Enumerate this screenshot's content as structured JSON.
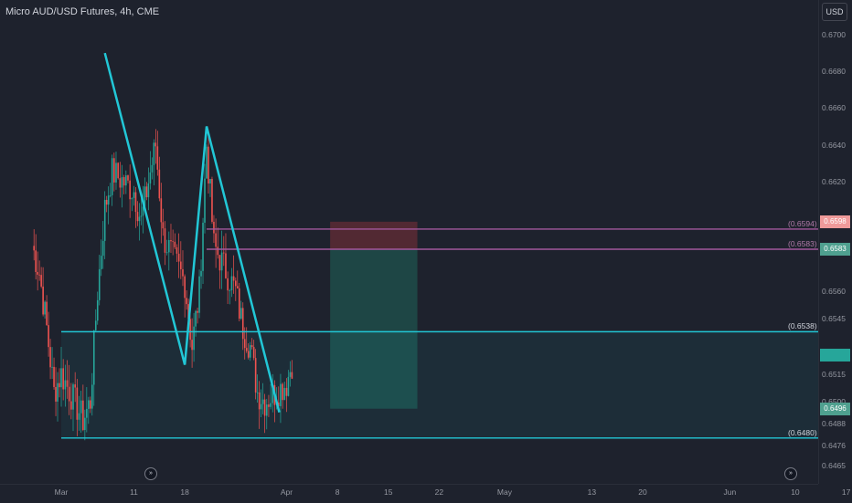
{
  "header": {
    "title": "Micro AUD/USD Futures, 4h, CME"
  },
  "price_scale": {
    "currency": "USD",
    "ticks": [
      {
        "label": "0.6700",
        "value": 0.67
      },
      {
        "label": "0.6680",
        "value": 0.668
      },
      {
        "label": "0.6660",
        "value": 0.666
      },
      {
        "label": "0.6640",
        "value": 0.664
      },
      {
        "label": "0.6620",
        "value": 0.662
      },
      {
        "label": "0.6560",
        "value": 0.656
      },
      {
        "label": "0.6545",
        "value": 0.6545
      },
      {
        "label": "0.6515",
        "value": 0.6515
      },
      {
        "label": "0.6500",
        "value": 0.65
      },
      {
        "label": "0.6488",
        "value": 0.6488
      },
      {
        "label": "0.6476",
        "value": 0.6476
      },
      {
        "label": "0.6465",
        "value": 0.6465
      }
    ],
    "badges": [
      {
        "label": "0.6598",
        "value": 0.6598,
        "color": "#ef9a9a"
      },
      {
        "label": "0.6583",
        "value": 0.6583,
        "color": "#4fa08f"
      },
      {
        "label": "",
        "value": 0.6525,
        "color": "#26a69a"
      },
      {
        "label": "0.6496",
        "value": 0.6496,
        "color": "#4fa08f"
      }
    ]
  },
  "levels": [
    {
      "label": "(0.6594)",
      "value": 0.6594,
      "color": "#a1579c",
      "start_date": "2024-03-21"
    },
    {
      "label": "(0.6583)",
      "value": 0.6583,
      "color": "#a1579c",
      "start_date": "2024-03-21"
    },
    {
      "label": "(0.6538)",
      "value": 0.6538,
      "color": "#22c7d6",
      "start_date": "2024-03-01"
    },
    {
      "label": "(0.6480)",
      "value": 0.648,
      "color": "#22c7d6",
      "start_date": "2024-03-01"
    }
  ],
  "time_axis": {
    "labels": [
      {
        "label": "Mar",
        "date": "2024-03-01"
      },
      {
        "label": "11",
        "date": "2024-03-11"
      },
      {
        "label": "18",
        "date": "2024-03-18"
      },
      {
        "label": "Apr",
        "date": "2024-04-01"
      },
      {
        "label": "8",
        "date": "2024-04-08"
      },
      {
        "label": "15",
        "date": "2024-04-15"
      },
      {
        "label": "22",
        "date": "2024-04-22"
      },
      {
        "label": "May",
        "date": "2024-05-01"
      },
      {
        "label": "13",
        "date": "2024-05-13"
      },
      {
        "label": "20",
        "date": "2024-05-20"
      },
      {
        "label": "Jun",
        "date": "2024-06-01"
      },
      {
        "label": "10",
        "date": "2024-06-10"
      },
      {
        "label": "17",
        "date": "2024-06-17"
      }
    ]
  },
  "colors": {
    "background": "#1e222d",
    "up_candle": "#26a69a",
    "down_candle": "#ef5350",
    "pattern_line": "#22c7d6",
    "stop_zone": "#5c2a35",
    "target_zone": "#1e4a48"
  },
  "chart_data": {
    "type": "candlestick",
    "symbol": "Micro AUD/USD Futures",
    "interval": "4h",
    "exchange": "CME",
    "ylim": [
      0.6462,
      0.6705
    ],
    "close_series": [
      {
        "date": "2024-02-26",
        "close": 0.6585
      },
      {
        "date": "2024-02-27",
        "close": 0.657
      },
      {
        "date": "2024-02-28",
        "close": 0.654
      },
      {
        "date": "2024-02-29",
        "close": 0.6505
      },
      {
        "date": "2024-03-01",
        "close": 0.6515
      },
      {
        "date": "2024-03-04",
        "close": 0.649
      },
      {
        "date": "2024-03-05",
        "close": 0.65
      },
      {
        "date": "2024-03-06",
        "close": 0.656
      },
      {
        "date": "2024-03-07",
        "close": 0.6605
      },
      {
        "date": "2024-03-08",
        "close": 0.6625
      },
      {
        "date": "2024-03-11",
        "close": 0.6615
      },
      {
        "date": "2024-03-12",
        "close": 0.6598
      },
      {
        "date": "2024-03-13",
        "close": 0.662
      },
      {
        "date": "2024-03-14",
        "close": 0.664
      },
      {
        "date": "2024-03-15",
        "close": 0.659
      },
      {
        "date": "2024-03-18",
        "close": 0.6565
      },
      {
        "date": "2024-03-19",
        "close": 0.653
      },
      {
        "date": "2024-03-20",
        "close": 0.656
      },
      {
        "date": "2024-03-21",
        "close": 0.664
      },
      {
        "date": "2024-03-22",
        "close": 0.6585
      },
      {
        "date": "2024-03-25",
        "close": 0.656
      },
      {
        "date": "2024-03-26",
        "close": 0.654
      },
      {
        "date": "2024-03-27",
        "close": 0.653
      },
      {
        "date": "2024-03-28",
        "close": 0.6505
      },
      {
        "date": "2024-03-29",
        "close": 0.65
      },
      {
        "date": "2024-04-01",
        "close": 0.651
      },
      {
        "date": "2024-04-02",
        "close": 0.6525
      }
    ],
    "pattern_points": [
      {
        "date": "2024-03-07",
        "price": 0.669
      },
      {
        "date": "2024-03-18",
        "price": 0.652
      },
      {
        "date": "2024-03-21",
        "price": 0.665
      },
      {
        "date": "2024-03-31",
        "price": 0.6494
      }
    ],
    "position": {
      "start_date": "2024-04-07",
      "end_date": "2024-04-19",
      "stop": 0.6598,
      "entry": 0.6583,
      "target": 0.6496
    }
  }
}
